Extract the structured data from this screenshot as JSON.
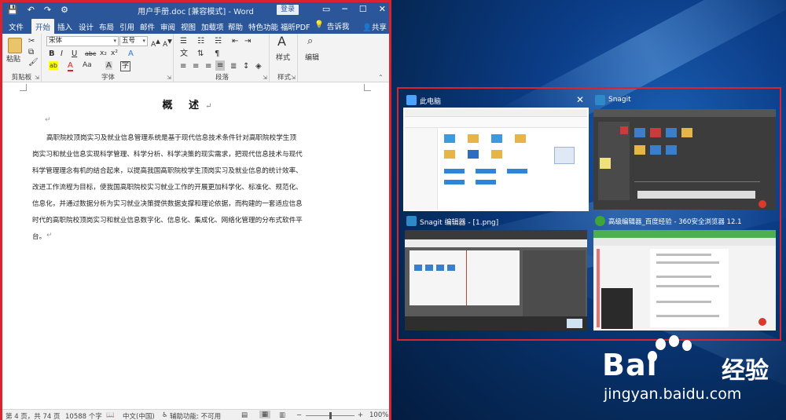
{
  "word": {
    "qat": [
      "💾",
      "↶",
      "↷",
      "⚙"
    ],
    "title": "用户手册.doc [兼容模式] - Word",
    "login": "登录",
    "window_controls": [
      "▭",
      "─",
      "☐",
      "✕"
    ],
    "tabs": [
      "文件",
      "开始",
      "插入",
      "设计",
      "布局",
      "引用",
      "邮件",
      "审阅",
      "视图",
      "加载项",
      "帮助",
      "特色功能",
      "福昕PDF"
    ],
    "active_tab": "开始",
    "tell_me": "告诉我",
    "share": "共享",
    "ribbon": {
      "clipboard": {
        "label": "剪贴板",
        "paste": "粘贴"
      },
      "font": {
        "label": "字体",
        "font_name": "宋体",
        "font_size": "五号",
        "buttons": [
          "B",
          "I",
          "U",
          "abc",
          "x₂",
          "x²",
          "A",
          "A",
          "Aa",
          "A"
        ]
      },
      "paragraph": {
        "label": "段落"
      },
      "styles": {
        "label": "样式",
        "button": "样式"
      },
      "editing": {
        "button": "编辑"
      }
    },
    "document": {
      "title": "概  述",
      "paragraph_lines": [
        "高职院校顶岗实习及就业信息管理系统是基于现代信息技术条件针对高职院校学生顶",
        "岗实习和就业信息实现科学管理、科学分析、科学决策的现实需求，把现代信息技术与现代",
        "科学管理理念有机的结合起来，以提高我国高职院校学生顶岗实习及就业信息的统计效率、",
        "改进工作流程为目标，使我国高职院校实习就业工作的开展更加科学化、标准化、规范化、",
        "信息化，并通过数据分析为实习就业决策提供数据支撑和理论依据，而构建的一套适应信息",
        "时代的高职院校顶岗实习和就业信息数字化、信息化、集成化、网络化管理的分布式软件平",
        "台。"
      ]
    },
    "status": {
      "page": "第 4 页，共 74 页",
      "words": "10588 个字",
      "language": "中文(中国)",
      "accessibility": "辅助功能: 不可用",
      "zoom": "100%"
    }
  },
  "task_view": {
    "windows": [
      {
        "title": "此电脑",
        "icon": "computer-icon",
        "color": "#1e88e5",
        "selected": true
      },
      {
        "title": "Snagit",
        "icon": "snagit-icon",
        "color": "#2d89c8",
        "selected": false
      },
      {
        "title": "Snagit 编辑器 - [1.png]",
        "icon": "snagit-editor-icon",
        "color": "#2d89c8",
        "selected": false
      },
      {
        "title": "高级编辑器_百度经验 - 360安全浏览器 12.1",
        "icon": "browser-360-icon",
        "color": "#3fa535",
        "selected": false
      }
    ]
  },
  "watermark": {
    "brand": "Bai",
    "brand_suffix": "经验",
    "url": "jingyan.baidu.com"
  },
  "colors": {
    "word_blue": "#2b579a",
    "highlight_red": "#d9232e"
  }
}
